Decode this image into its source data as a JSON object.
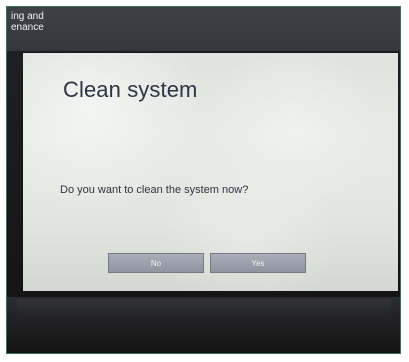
{
  "top_bar": {
    "text": "ing and\nenance"
  },
  "dialog": {
    "title": "Clean system",
    "message": "Do you want to clean the system now?",
    "buttons": {
      "no": "No",
      "yes": "Yes"
    }
  }
}
